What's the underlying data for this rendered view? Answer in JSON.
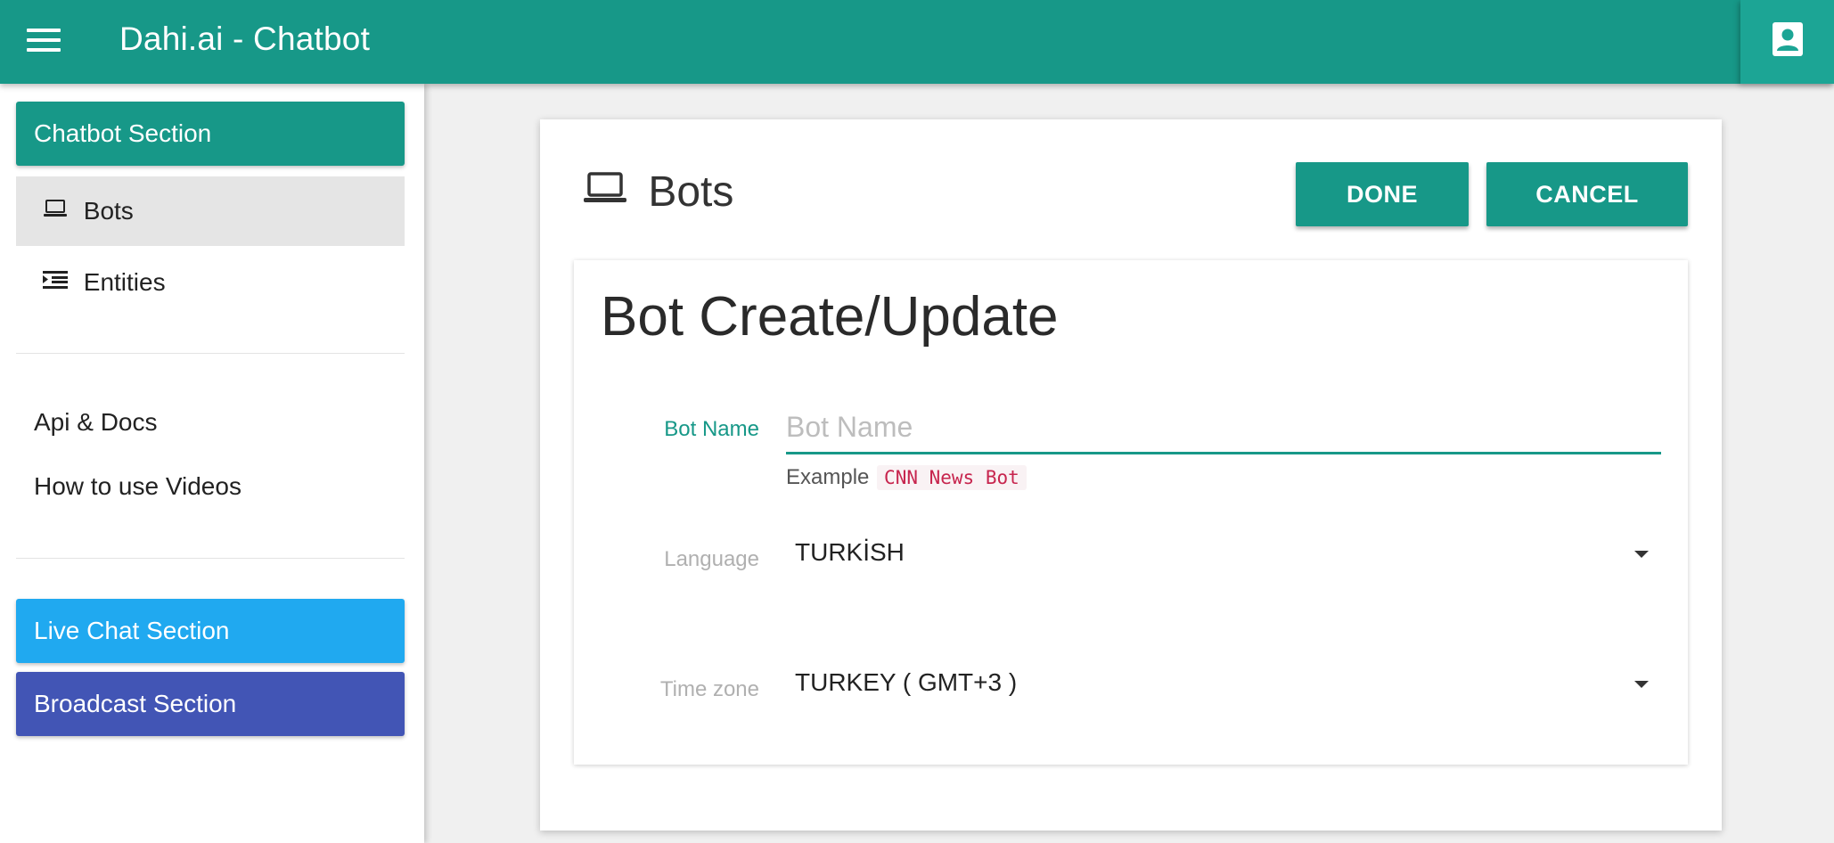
{
  "topbar": {
    "title": "Dahi.ai - Chatbot",
    "menu_icon": "hamburger-menu-icon",
    "account_icon": "account-box-icon",
    "color": "#179888"
  },
  "sidebar": {
    "chatbot_section": "Chatbot Section",
    "items": [
      {
        "label": "Bots",
        "icon": "laptop-icon",
        "active": true
      },
      {
        "label": "Entities",
        "icon": "format-indent-icon",
        "active": false
      }
    ],
    "links": [
      {
        "label": "Api & Docs"
      },
      {
        "label": "How to use Videos"
      }
    ],
    "live_chat_section": "Live Chat Section",
    "broadcast_section": "Broadcast Section",
    "colors": {
      "chatbot": "#179888",
      "live_chat": "#20a9f0",
      "broadcast": "#4255b5"
    }
  },
  "main": {
    "heading": "Bots",
    "heading_icon": "laptop-icon",
    "done_label": "DONE",
    "cancel_label": "CANCEL",
    "form": {
      "title": "Bot Create/Update",
      "bot_name": {
        "label": "Bot Name",
        "value": "",
        "placeholder": "Bot Name",
        "hint_prefix": "Example",
        "hint_example": "CNN News Bot"
      },
      "language": {
        "label": "Language",
        "value": "TURKİSH"
      },
      "timezone": {
        "label": "Time zone",
        "value": "TURKEY ( GMT+3 )"
      }
    }
  }
}
